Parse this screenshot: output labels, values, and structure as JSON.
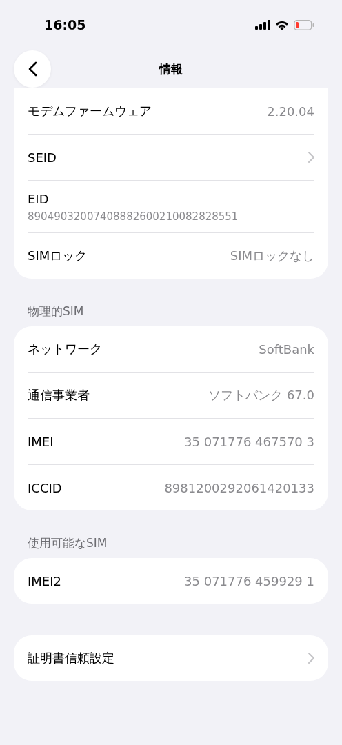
{
  "status_bar": {
    "time": "16:05"
  },
  "nav": {
    "title": "情報"
  },
  "sections": [
    {
      "rows": [
        {
          "kind": "value",
          "label": "モデムファームウェア",
          "value": "2.20.04"
        },
        {
          "kind": "link",
          "label": "SEID"
        },
        {
          "kind": "stacked",
          "label": "EID",
          "value": "89049032007408882600210082828551"
        },
        {
          "kind": "value",
          "label": "SIMロック",
          "value": "SIMロックなし"
        }
      ]
    },
    {
      "header": "物理的SIM",
      "rows": [
        {
          "kind": "value",
          "label": "ネットワーク",
          "value": "SoftBank"
        },
        {
          "kind": "value",
          "label": "通信事業者",
          "value": "ソフトバンク 67.0"
        },
        {
          "kind": "value",
          "label": "IMEI",
          "value": "35 071776 467570 3"
        },
        {
          "kind": "value",
          "label": "ICCID",
          "value": "8981200292061420133"
        }
      ]
    },
    {
      "header": "使用可能なSIM",
      "rows": [
        {
          "kind": "value",
          "label": "IMEI2",
          "value": "35 071776 459929 1"
        }
      ]
    },
    {
      "rows": [
        {
          "kind": "link",
          "label": "証明書信頼設定"
        }
      ]
    }
  ]
}
